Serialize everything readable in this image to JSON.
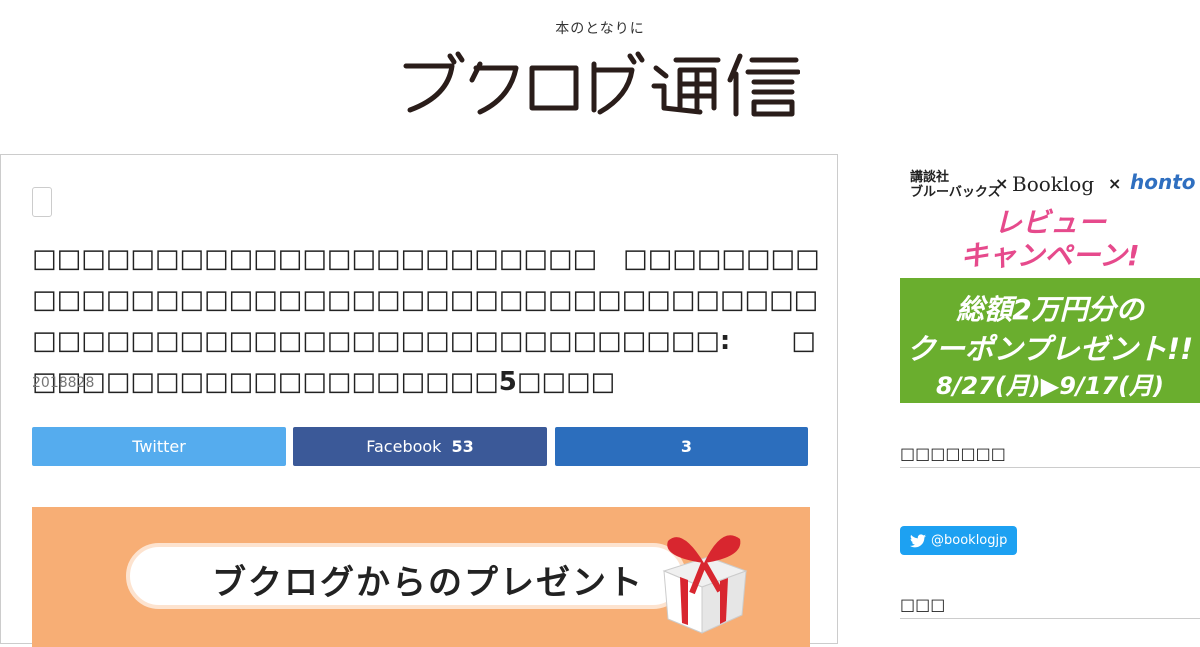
{
  "header": {
    "tagline": "本のとなりに",
    "site_name": "ブクログ通信"
  },
  "article": {
    "category": "",
    "title": "□□□□□□□□□□□□□□□□□□□□□□□　□□□□□□□□□□□□□□□□□□□□□□□□□□□□□□□□□□□□□□□□□□□□□□□□□□□□□□□□□□□□□□□□□□□□: 　　□□□□□□□□□□□□□□□□□□□□5□□□□",
    "date": "2018828"
  },
  "share": {
    "twitter_label": "Twitter",
    "facebook_label": "Facebook",
    "facebook_count": "53",
    "hatena_count": "3"
  },
  "banner": {
    "text": "ブクログからのプレゼント"
  },
  "ad": {
    "publisher": "講談社\nブルーバックス",
    "x1": "×",
    "booklog": "Booklog",
    "x2": "×",
    "honto": "honto",
    "review": "レビュー\nキャンペーン!",
    "line1": "総額2万円分の",
    "line2": "クーポンプレゼント!!",
    "line3": "8/27(月)▶9/17(月)"
  },
  "sidebar": {
    "heading1": "□□□□□□□",
    "follow_label": "@booklogjp",
    "heading2": "□□□"
  },
  "colors": {
    "twitter": "#55acee",
    "facebook": "#3b5998",
    "hatena": "#2c6ebd",
    "banner_bg": "#f7ae75",
    "ad_green": "#6aae2e",
    "ad_pink": "#e64a8c"
  }
}
